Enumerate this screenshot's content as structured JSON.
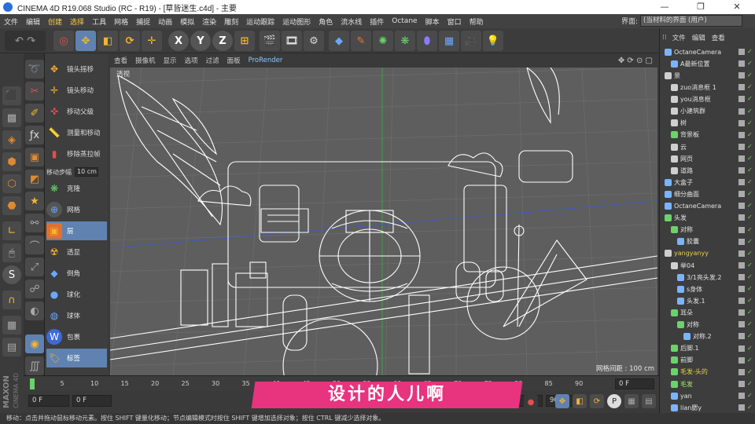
{
  "window": {
    "title": "CINEMA 4D R19.068 Studio (RC - R19) - [草皆迷生.c4d] - 主要",
    "minimize": "—",
    "maximize": "❐",
    "close": "✕"
  },
  "menu": {
    "items": [
      "文件",
      "编辑",
      "创建",
      "选择",
      "工具",
      "网格",
      "捕捉",
      "动画",
      "模拟",
      "渲染",
      "雕刻",
      "运动跟踪",
      "运动图形",
      "角色",
      "流水线",
      "插件",
      "Octane",
      "脚本",
      "窗口",
      "帮助"
    ],
    "layout_label": "界面:",
    "layout_value": "(当材料的界面 (用户)"
  },
  "toolbar": {
    "axis_x": "X",
    "axis_y": "Y",
    "axis_z": "Z"
  },
  "palette": {
    "items": [
      {
        "label": "镜头摇移",
        "icon": "pan-icon"
      },
      {
        "label": "镜头移动",
        "icon": "dolly-icon"
      },
      {
        "label": "移动父级",
        "icon": "move-parent-icon"
      },
      {
        "label": "测量和移动",
        "icon": "measure-icon"
      },
      {
        "label": "移除蒸拉帧",
        "icon": "remove-frame-icon"
      }
    ],
    "step_label": "移动步幅",
    "step_value": "10 cm",
    "items2": [
      {
        "label": "克隆",
        "icon": "clone-icon"
      },
      {
        "label": "网格",
        "icon": "grid-icon"
      },
      {
        "label": "层",
        "icon": "layer-icon"
      },
      {
        "label": "透显",
        "icon": "radiation-icon"
      },
      {
        "label": "倒角",
        "icon": "bevel-icon"
      },
      {
        "label": "球化",
        "icon": "sphere-icon"
      },
      {
        "label": "球体",
        "icon": "ball-icon"
      },
      {
        "label": "包裹",
        "icon": "wrap-icon"
      },
      {
        "label": "标签",
        "icon": "tag-icon"
      }
    ]
  },
  "viewport": {
    "menu": [
      "查看",
      "摄像机",
      "显示",
      "选项",
      "过滤",
      "面板",
      "ProRender"
    ],
    "grid_info": "网格间距 : 100 cm",
    "corner": "透视"
  },
  "timeline": {
    "ticks": [
      "0",
      "5",
      "10",
      "15",
      "20",
      "25",
      "30",
      "35",
      "40",
      "45",
      "50",
      "55",
      "60",
      "65",
      "70",
      "75",
      "80",
      "85",
      "90"
    ],
    "frame": "0 F"
  },
  "transport": {
    "start": "0 F",
    "current": "0 F",
    "end": "90 F",
    "end2": "90 F"
  },
  "banner": {
    "text": "设计的人儿啊"
  },
  "status": {
    "text": "移动：点击并拖动鼠标移动元素。按住 SHIFT 键量化移动；节点编辑模式时按住 SHIFT 键增加选择对象；按住 CTRL 键减少选择对象。"
  },
  "objects": {
    "tabs": [
      "文件",
      "编辑",
      "查看"
    ],
    "rows": [
      {
        "name": "OctaneCamera",
        "indent": 0,
        "color": "#7ab4ff",
        "style": ""
      },
      {
        "name": "A最新位置",
        "indent": 1,
        "color": "#7ab4ff",
        "style": ""
      },
      {
        "name": "景",
        "indent": 0,
        "color": "#cfcfcf",
        "style": ""
      },
      {
        "name": "zuo消息框 1",
        "indent": 1,
        "color": "#cfcfcf",
        "style": ""
      },
      {
        "name": "you消息框",
        "indent": 1,
        "color": "#cfcfcf",
        "style": ""
      },
      {
        "name": "小建筑群",
        "indent": 1,
        "color": "#cfcfcf",
        "style": ""
      },
      {
        "name": "树",
        "indent": 1,
        "color": "#cfcfcf",
        "style": ""
      },
      {
        "name": "背景板",
        "indent": 1,
        "color": "#6ad36a",
        "style": ""
      },
      {
        "name": "云",
        "indent": 1,
        "color": "#cfcfcf",
        "style": ""
      },
      {
        "name": "网页",
        "indent": 1,
        "color": "#cfcfcf",
        "style": ""
      },
      {
        "name": "道路",
        "indent": 1,
        "color": "#cfcfcf",
        "style": ""
      },
      {
        "name": "大盒子",
        "indent": 0,
        "color": "#7ab4ff",
        "style": ""
      },
      {
        "name": "细分曲面",
        "indent": 0,
        "color": "#7ab4ff",
        "style": ""
      },
      {
        "name": "OctaneCamera",
        "indent": 0,
        "color": "#7ab4ff",
        "style": ""
      },
      {
        "name": "头发",
        "indent": 0,
        "color": "#6ad36a",
        "style": ""
      },
      {
        "name": "对称",
        "indent": 1,
        "color": "#6ad36a",
        "style": ""
      },
      {
        "name": "胶囊",
        "indent": 2,
        "color": "#7ab4ff",
        "style": ""
      },
      {
        "name": "yangyanyy",
        "indent": 0,
        "color": "#cfcfcf",
        "style": "yellow"
      },
      {
        "name": "举04",
        "indent": 1,
        "color": "#cfcfcf",
        "style": ""
      },
      {
        "name": "3/1亮头发.2",
        "indent": 2,
        "color": "#7ab4ff",
        "style": ""
      },
      {
        "name": "s身体",
        "indent": 2,
        "color": "#7ab4ff",
        "style": ""
      },
      {
        "name": "头发.1",
        "indent": 2,
        "color": "#7ab4ff",
        "style": ""
      },
      {
        "name": "耳朵",
        "indent": 1,
        "color": "#6ad36a",
        "style": ""
      },
      {
        "name": "对称",
        "indent": 2,
        "color": "#6ad36a",
        "style": ""
      },
      {
        "name": "对称.2",
        "indent": 3,
        "color": "#7ab4ff",
        "style": ""
      },
      {
        "name": "后脚.1",
        "indent": 1,
        "color": "#6ad36a",
        "style": ""
      },
      {
        "name": "前脚",
        "indent": 1,
        "color": "#6ad36a",
        "style": ""
      },
      {
        "name": "毛发-头的",
        "indent": 1,
        "color": "#6ad36a",
        "style": "yellow"
      },
      {
        "name": "毛发",
        "indent": 1,
        "color": "#6ad36a",
        "style": "green"
      },
      {
        "name": "yan",
        "indent": 1,
        "color": "#7ab4ff",
        "style": ""
      },
      {
        "name": "lian腮y",
        "indent": 1,
        "color": "#7ab4ff",
        "style": ""
      }
    ]
  },
  "brand": {
    "maxon": "MAXON",
    "c4d": "CINEMA 4D"
  }
}
